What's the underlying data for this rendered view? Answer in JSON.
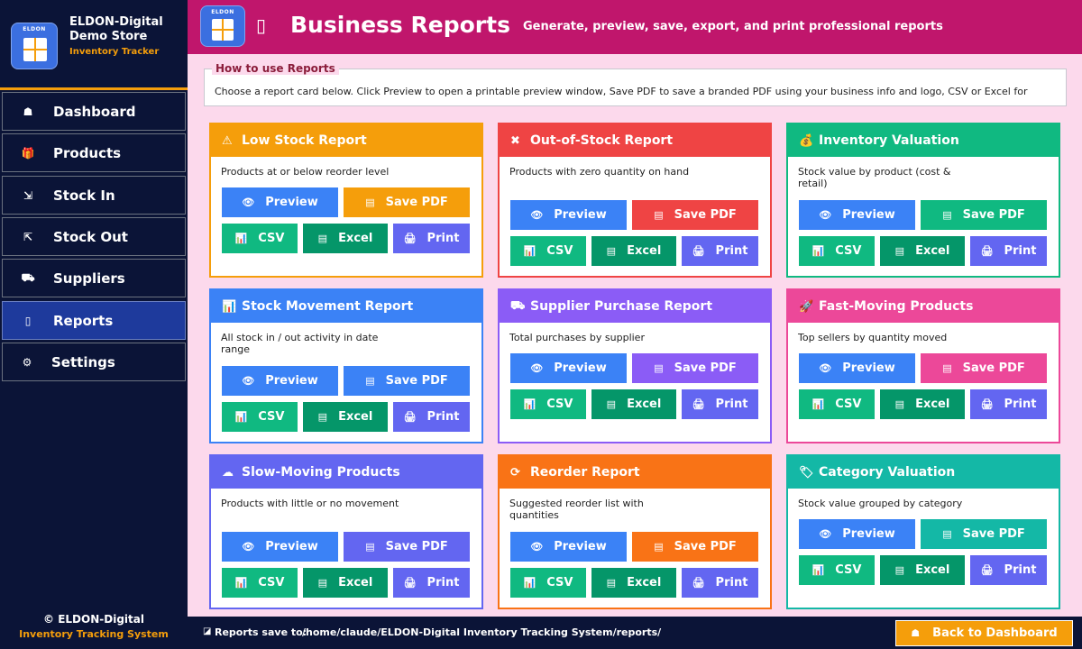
{
  "brand": {
    "logo_tag": "ELDON",
    "name": "ELDON-Digital Demo Store",
    "subtitle": "Inventory Tracker"
  },
  "nav": [
    {
      "label": "Dashboard",
      "icon": "home-icon",
      "glyph": "☗",
      "active": false
    },
    {
      "label": "Products",
      "icon": "gift-icon",
      "glyph": "🎁",
      "active": false
    },
    {
      "label": "Stock In",
      "icon": "stock-in-icon",
      "glyph": "⇲",
      "active": false
    },
    {
      "label": "Stock Out",
      "icon": "stock-out-icon",
      "glyph": "⇱",
      "active": false
    },
    {
      "label": "Suppliers",
      "icon": "truck-icon",
      "glyph": "⛟",
      "active": false
    },
    {
      "label": "Reports",
      "icon": "report-icon",
      "glyph": "▯",
      "active": true
    },
    {
      "label": "Settings",
      "icon": "gear-icon",
      "glyph": "⚙",
      "active": false
    }
  ],
  "sidebar_footer": {
    "line1": "© ELDON-Digital",
    "line2": "Inventory Tracking System"
  },
  "header": {
    "logo_tag": "ELDON",
    "title": "Business Reports",
    "subtitle": "Generate, preview, save, export, and print professional reports"
  },
  "howto": {
    "title": "How to use Reports",
    "text": "Choose a report card below. Click  Preview  to open a printable preview window,  Save PDF  to save a branded PDF using your business info and logo,  CSV  or  Excel  for"
  },
  "buttons": {
    "preview": "Preview",
    "save_pdf": "Save PDF",
    "csv": "CSV",
    "excel": "Excel",
    "print": "Print"
  },
  "colors": {
    "preview": "#3b82f6",
    "csv": "#10b981",
    "excel": "#059669",
    "print": "#6366f1"
  },
  "cards": [
    {
      "title": "Low Stock Report",
      "icon": "warning-icon",
      "glyph": "⚠",
      "desc": "Products at or below reorder level",
      "color": "#f59e0b"
    },
    {
      "title": "Out-of-Stock Report",
      "icon": "x-icon",
      "glyph": "✖",
      "desc": "Products with zero quantity on hand",
      "color": "#ef4444"
    },
    {
      "title": "Inventory Valuation",
      "icon": "money-bag-icon",
      "glyph": "💰",
      "desc": "Stock value by product (cost & retail)",
      "color": "#10b981"
    },
    {
      "title": "Stock Movement Report",
      "icon": "bar-chart-icon",
      "glyph": "📊",
      "desc": "All stock in / out activity in date range",
      "color": "#3b82f6"
    },
    {
      "title": "Supplier Purchase Report",
      "icon": "truck-icon",
      "glyph": "⛟",
      "desc": "Total purchases by supplier",
      "color": "#8b5cf6"
    },
    {
      "title": "Fast-Moving Products",
      "icon": "rocket-icon",
      "glyph": "🚀",
      "desc": "Top sellers by quantity moved",
      "color": "#ec4899"
    },
    {
      "title": "Slow-Moving Products",
      "icon": "cloud-icon",
      "glyph": "☁",
      "desc": "Products with little or no movement",
      "color": "#6366f1"
    },
    {
      "title": "Reorder Report",
      "icon": "refresh-icon",
      "glyph": "⟳",
      "desc": "Suggested reorder list with quantities",
      "color": "#f97316"
    },
    {
      "title": "Category Valuation",
      "icon": "tag-icon",
      "glyph": "🏷",
      "desc": "Stock value grouped by category",
      "color": "#14b8a6"
    }
  ],
  "footer": {
    "label": "Reports save to:",
    "path": "/home/claude/ELDON-Digital Inventory Tracking System/reports/",
    "back_button": "Back to Dashboard"
  }
}
